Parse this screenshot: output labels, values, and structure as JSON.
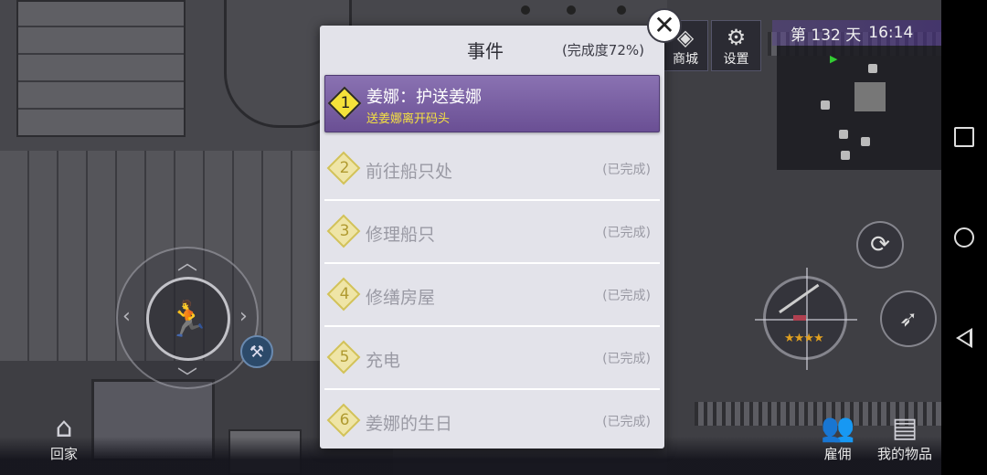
{
  "hud": {
    "shop_label": "商城",
    "settings_label": "设置",
    "day_text": "第 132 天",
    "time_text": "16:14"
  },
  "event_panel": {
    "title": "事件",
    "completion": "(完成度72%)",
    "tasks": [
      {
        "number": "1",
        "name": "姜娜：护送姜娜",
        "subtitle": "送姜娜离开码头",
        "status": "",
        "state": "active"
      },
      {
        "number": "2",
        "name": "前往船只处",
        "status": "(已完成)",
        "state": "done"
      },
      {
        "number": "3",
        "name": "修理船只",
        "status": "(已完成)",
        "state": "done"
      },
      {
        "number": "4",
        "name": "修缮房屋",
        "status": "(已完成)",
        "state": "done"
      },
      {
        "number": "5",
        "name": "充电",
        "status": "(已完成)",
        "state": "done"
      },
      {
        "number": "6",
        "name": "姜娜的生日",
        "status": "(已完成)",
        "state": "done"
      }
    ]
  },
  "bottom": {
    "home_label": "回家",
    "hire_label": "雇佣",
    "items_label": "我的物品"
  },
  "weapon": {
    "stars": "★★★★"
  },
  "icons": {
    "close": "close-icon",
    "shop": "shop-icon",
    "settings": "gear-icon",
    "home": "house-icon",
    "hire": "people-icon",
    "items": "chest-icon",
    "reload": "reload-icon",
    "sprint": "sprint-icon",
    "move": "running-figure-icon",
    "tool": "tools-icon"
  },
  "colors": {
    "active_task": "#7a60a4",
    "panel_bg": "#e3e3ea",
    "task_subtitle": "#f6e240",
    "day_bar": "#5a4690"
  }
}
